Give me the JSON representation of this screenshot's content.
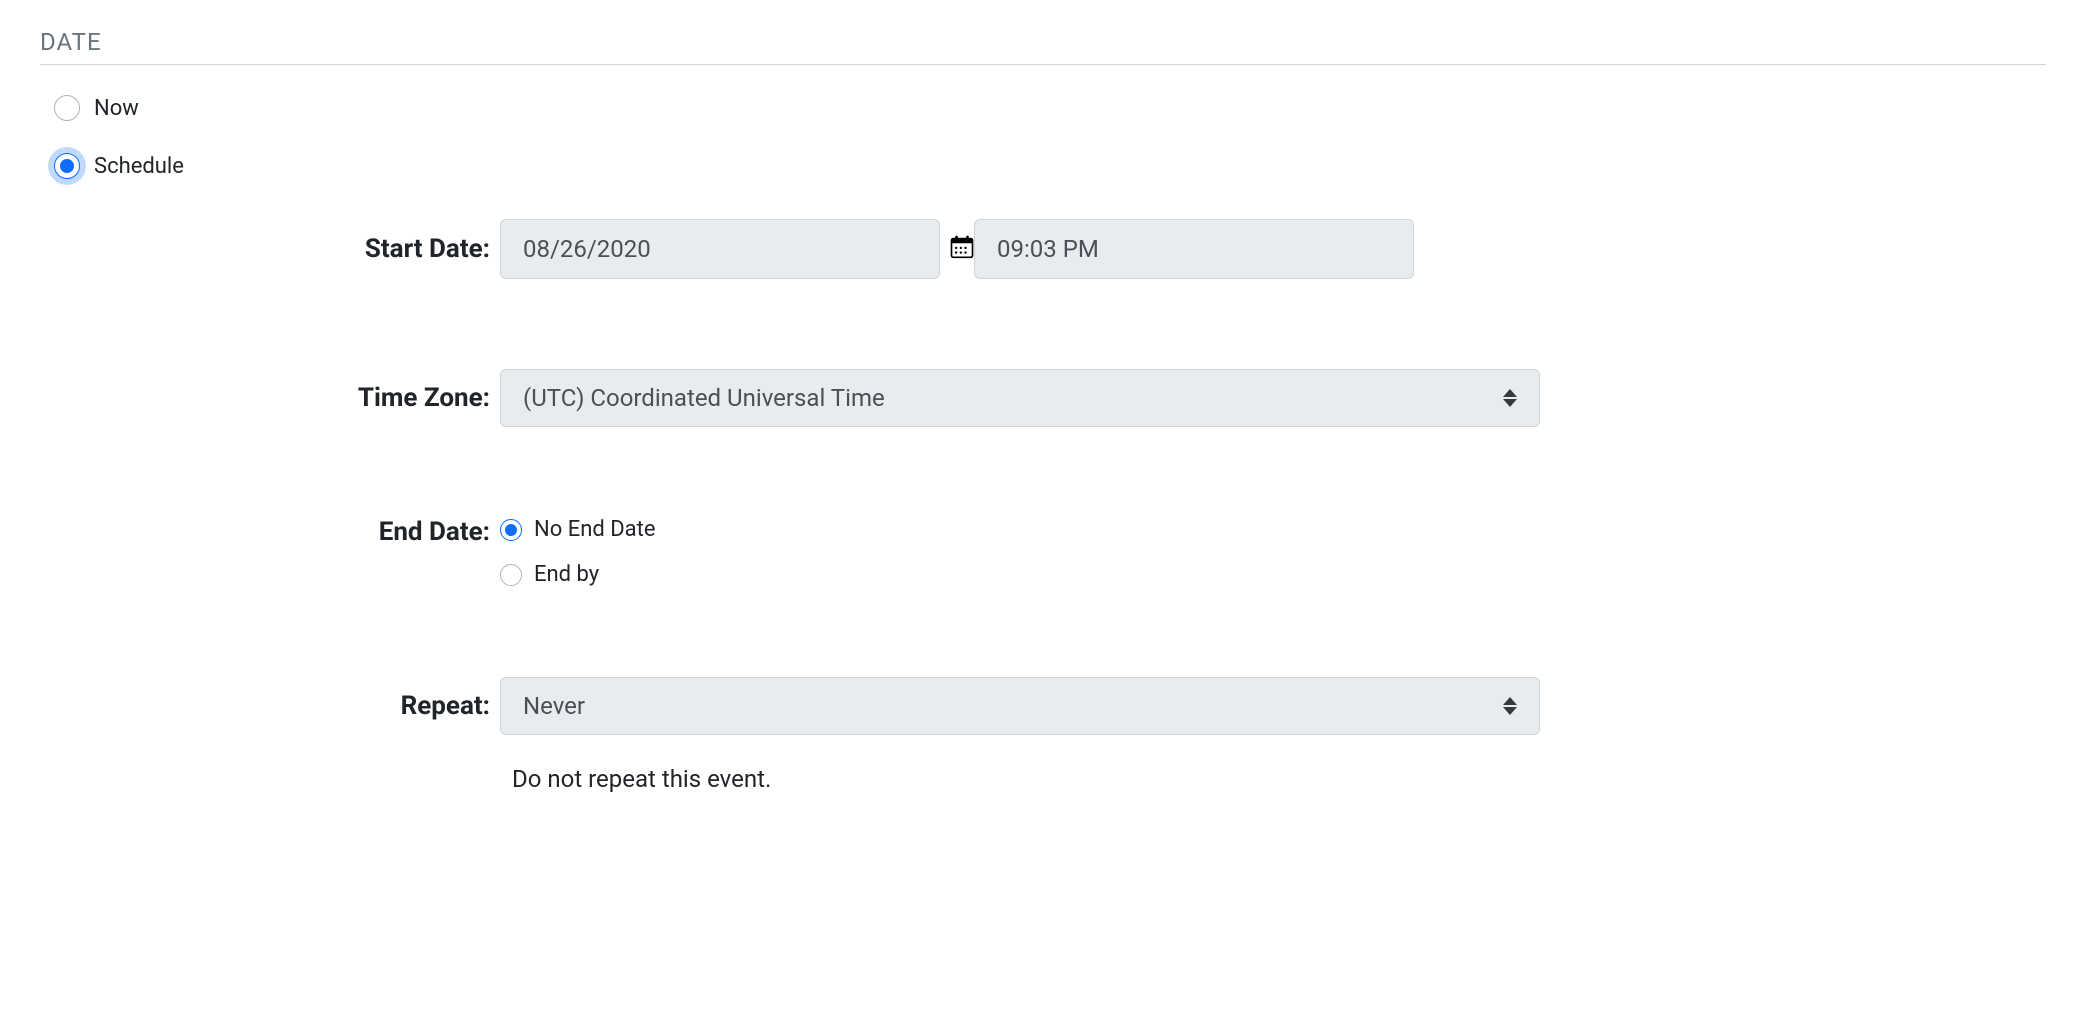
{
  "section": {
    "title": "DATE"
  },
  "dateMode": {
    "now_label": "Now",
    "schedule_label": "Schedule",
    "selected": "schedule"
  },
  "startDate": {
    "label": "Start Date:",
    "date_value": "08/26/2020",
    "time_value": "09:03 PM"
  },
  "timeZone": {
    "label": "Time Zone:",
    "value": "(UTC) Coordinated Universal Time"
  },
  "endDate": {
    "label": "End Date:",
    "no_end_label": "No End Date",
    "end_by_label": "End by",
    "selected": "no_end"
  },
  "repeat": {
    "label": "Repeat:",
    "value": "Never",
    "description": "Do not repeat this event."
  },
  "icons": {
    "calendar": "calendar"
  }
}
